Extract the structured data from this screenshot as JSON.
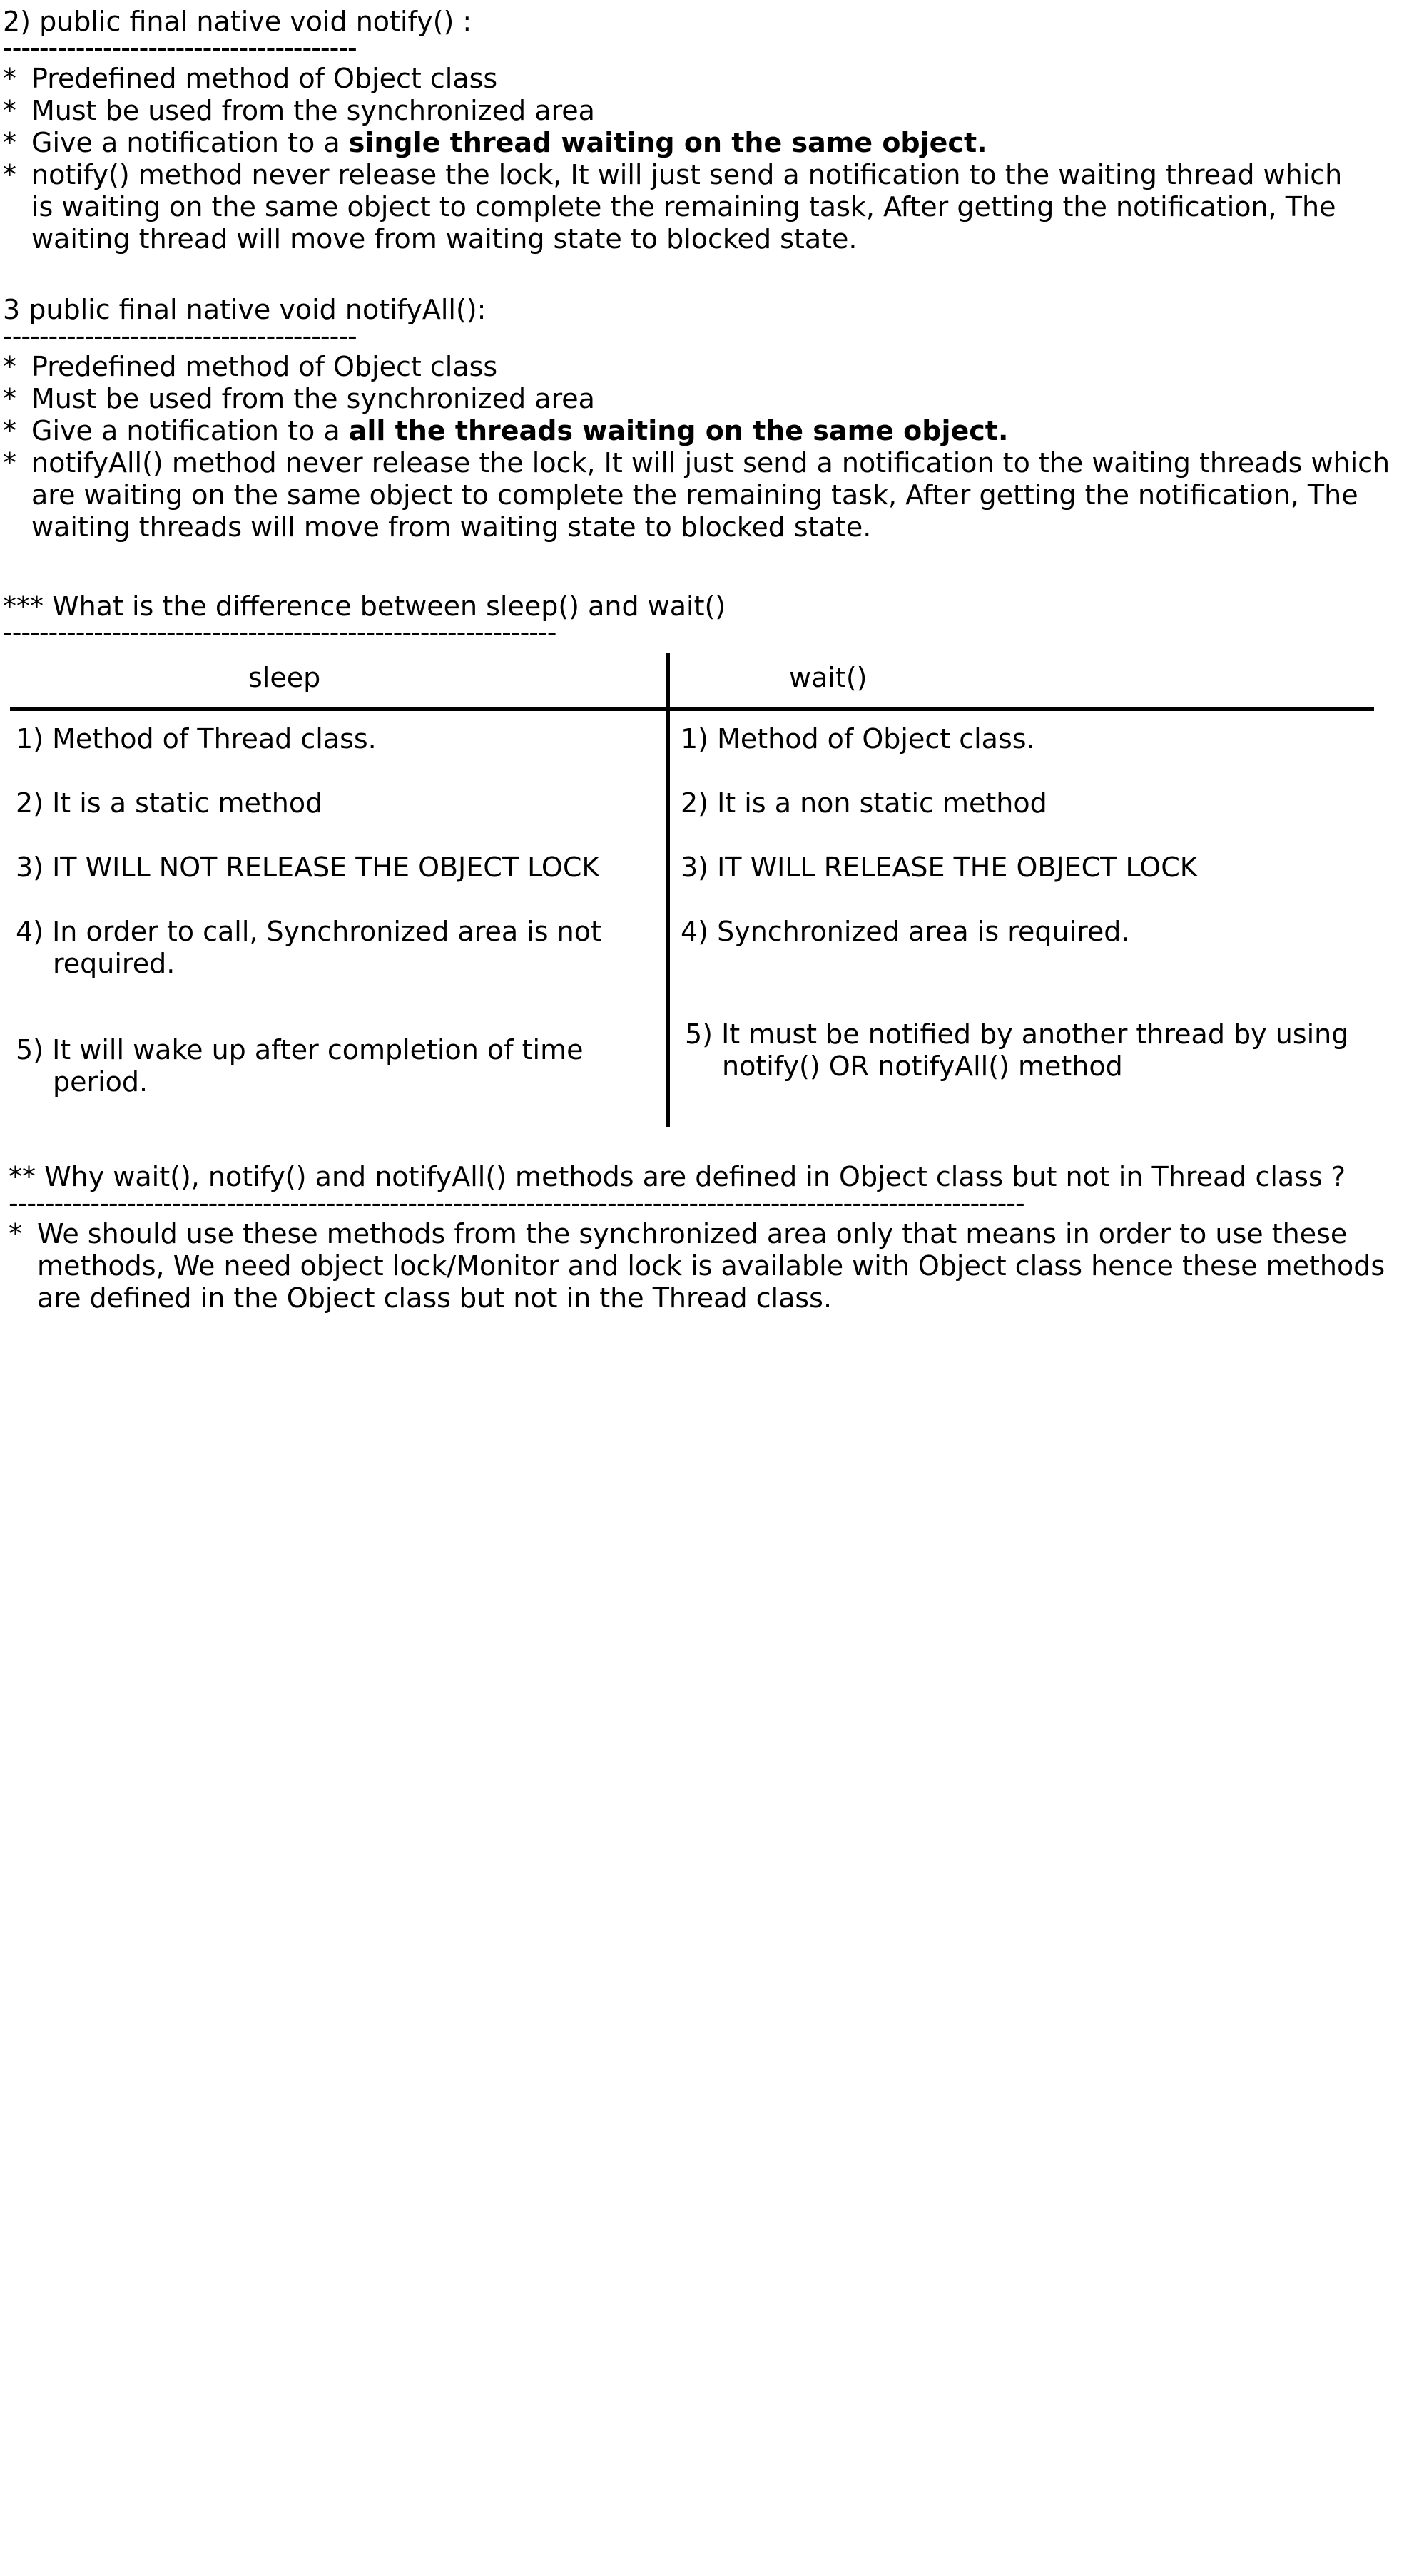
{
  "notify": {
    "heading": "2) public final native void notify() :",
    "underline": "---------------------------------------",
    "bullets": [
      {
        "text": "Predefined method of Object class"
      },
      {
        "text": "Must be used from the synchronized area"
      },
      {
        "prefix": "Give a notification to a ",
        "bold": "single thread waiting on the same object."
      },
      {
        "lines": [
          "notify() method never release the lock, It will just send a notification to the waiting thread which",
          "is waiting on the same object to complete the remaining task, After getting the notification, The",
          "waiting thread will move from waiting state to blocked state."
        ]
      }
    ]
  },
  "notifyAll": {
    "heading": "3 public final native void notifyAll():",
    "underline": "---------------------------------------",
    "bullets": [
      {
        "text": "Predefined method of Object class"
      },
      {
        "text": "Must be used from the synchronized area"
      },
      {
        "prefix": "Give a notification to a ",
        "bold": "all the threads waiting on the same object."
      },
      {
        "lines": [
          "notifyAll() method never release the lock, It will just send a notification to the waiting threads which",
          "are waiting on the same object to complete the remaining task, After getting the notification, The",
          "waiting threads will move from waiting state to blocked state."
        ]
      }
    ]
  },
  "difference": {
    "heading": "*** What is the difference between sleep() and wait()",
    "underline": "-------------------------------------------------------------",
    "columns": [
      "sleep",
      "wait()"
    ],
    "rows": [
      {
        "sleep": [
          "1) Method of Thread class."
        ],
        "wait": [
          "1) Method of Object class."
        ]
      },
      {
        "sleep": [
          "2) It is a static method"
        ],
        "wait": [
          "2) It is a non static method"
        ]
      },
      {
        "sleep": [
          "3) IT WILL NOT RELEASE THE OBJECT LOCK"
        ],
        "wait": [
          "3) IT WILL RELEASE THE OBJECT LOCK"
        ]
      },
      {
        "sleep": [
          "4) In order to call, Synchronized area is not",
          "required."
        ],
        "wait": [
          "4) Synchronized area is required."
        ]
      },
      {
        "sleep": [
          "5) It will wake up after completion of time",
          "period."
        ],
        "wait": [
          "5) It must be notified by another thread by using",
          "notify() OR notifyAll() method"
        ]
      }
    ]
  },
  "why": {
    "heading": "** Why wait(), notify() and notifyAll() methods are defined in Object class but not in Thread class ?",
    "underline": "----------------------------------------------------------------------------------------------------------------",
    "lines": [
      "We should use these methods from the synchronized area only that means in order to use these",
      "methods, We need object lock/Monitor and lock is available with Object class hence these methods",
      "are defined in the Object class but not in the Thread class."
    ]
  },
  "bullet_symbol": "*"
}
